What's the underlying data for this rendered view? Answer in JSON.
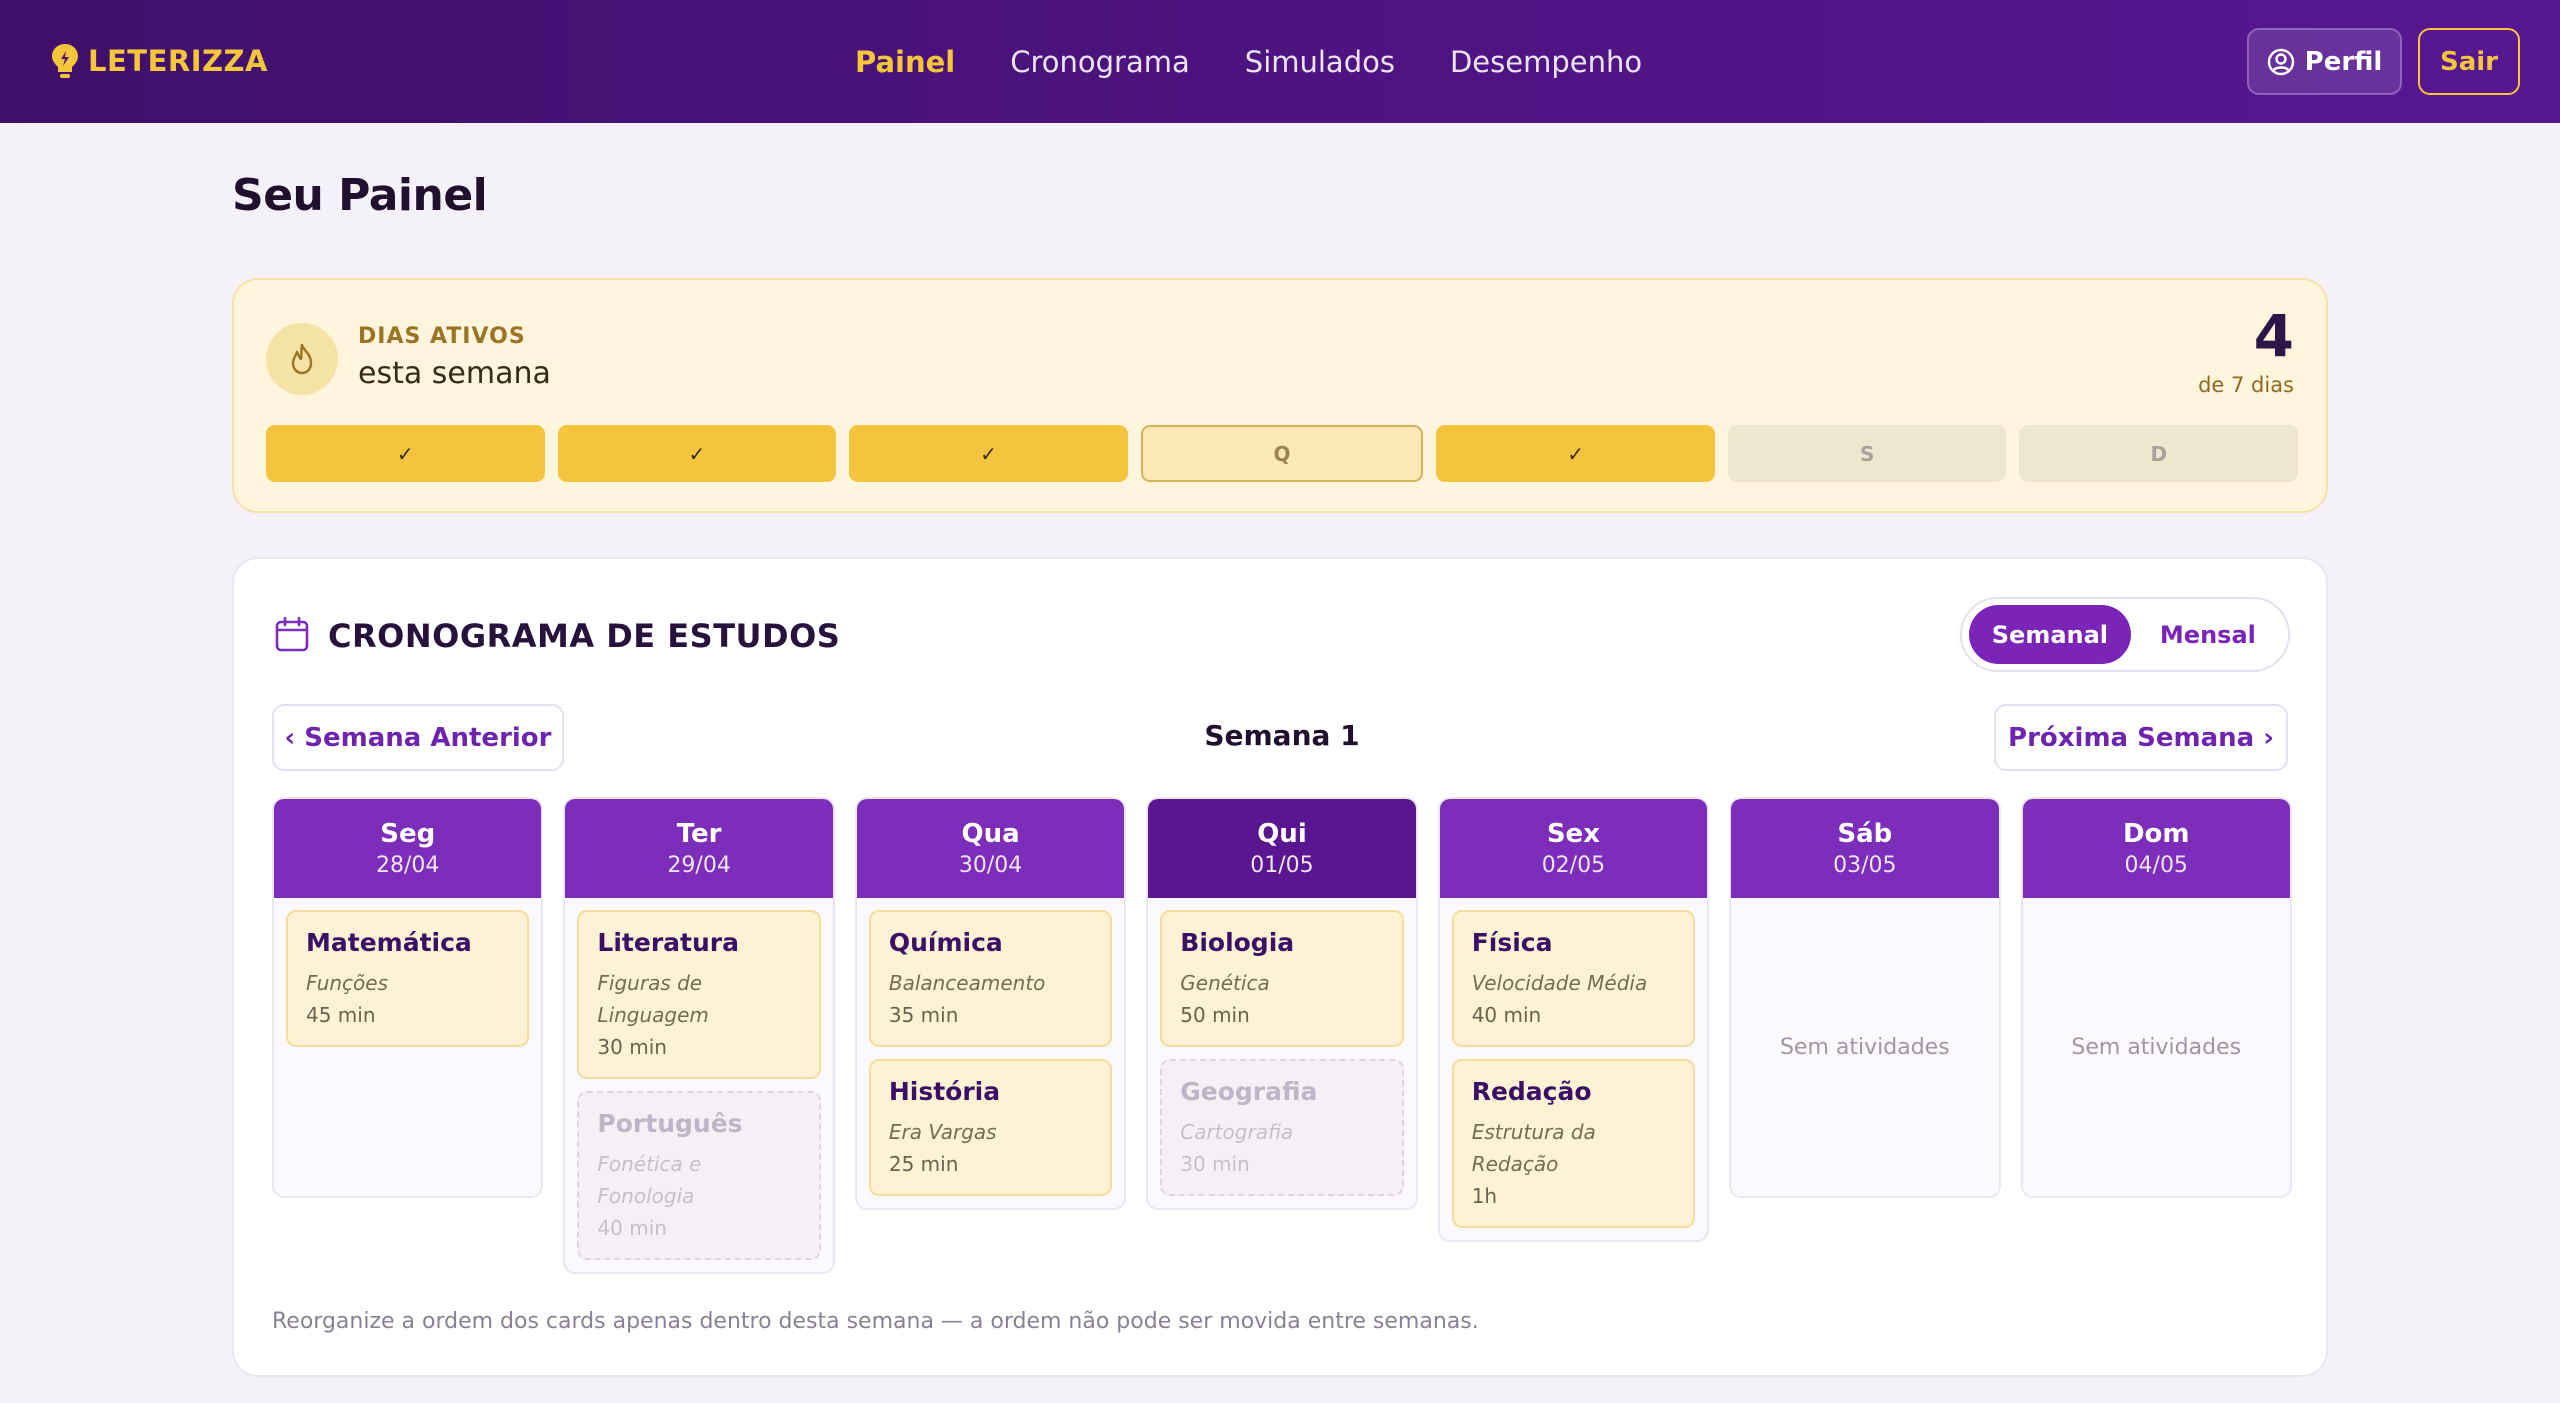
{
  "header": {
    "brand": "LETERIZZA",
    "nav": [
      "Painel",
      "Cronograma",
      "Simulados",
      "Desempenho"
    ],
    "active_nav": "Painel",
    "profile_label": "Perfil",
    "logout_label": "Sair"
  },
  "page": {
    "title": "Seu Painel"
  },
  "streak": {
    "label": "DIAS ATIVOS",
    "subtitle": "esta semana",
    "count": "4",
    "of_label": "de 7 dias",
    "days": [
      {
        "text": "✓",
        "state": "done"
      },
      {
        "text": "✓",
        "state": "done"
      },
      {
        "text": "✓",
        "state": "done"
      },
      {
        "text": "Q",
        "state": "today"
      },
      {
        "text": "✓",
        "state": "done"
      },
      {
        "text": "S",
        "state": "future"
      },
      {
        "text": "D",
        "state": "future"
      }
    ]
  },
  "schedule": {
    "title": "CRONOGRAMA DE ESTUDOS",
    "view_weekly": "Semanal",
    "view_monthly": "Mensal",
    "prev_week": "‹ Semana Anterior",
    "next_week": "Próxima Semana ›",
    "week_label": "Semana 1",
    "empty_text": "Sem atividades",
    "note": "Reorganize a ordem dos cards apenas dentro desta semana — a ordem não pode ser movida entre semanas.",
    "columns": [
      {
        "day": "Seg",
        "date": "28/04",
        "today": false,
        "tasks": [
          {
            "subject": "Matemática",
            "topic": "Funções",
            "duration": "45 min",
            "dim": false
          }
        ]
      },
      {
        "day": "Ter",
        "date": "29/04",
        "today": false,
        "tasks": [
          {
            "subject": "Literatura",
            "topic": "Figuras de Linguagem",
            "duration": "30 min",
            "dim": false
          },
          {
            "subject": "Português",
            "topic": "Fonética e Fonologia",
            "duration": "40 min",
            "dim": true
          }
        ]
      },
      {
        "day": "Qua",
        "date": "30/04",
        "today": false,
        "tasks": [
          {
            "subject": "Química",
            "topic": "Balanceamento",
            "duration": "35 min",
            "dim": false
          },
          {
            "subject": "História",
            "topic": "Era Vargas",
            "duration": "25 min",
            "dim": false
          }
        ]
      },
      {
        "day": "Qui",
        "date": "01/05",
        "today": true,
        "tasks": [
          {
            "subject": "Biologia",
            "topic": "Genética",
            "duration": "50 min",
            "dim": false
          },
          {
            "subject": "Geografia",
            "topic": "Cartografia",
            "duration": "30 min",
            "dim": true
          }
        ]
      },
      {
        "day": "Sex",
        "date": "02/05",
        "today": false,
        "tasks": [
          {
            "subject": "Física",
            "topic": "Velocidade Média",
            "duration": "40 min",
            "dim": false
          },
          {
            "subject": "Redação",
            "topic": "Estrutura da Redação",
            "duration": "1h",
            "dim": false
          }
        ]
      },
      {
        "day": "Sáb",
        "date": "03/05",
        "today": false,
        "tasks": []
      },
      {
        "day": "Dom",
        "date": "04/05",
        "today": false,
        "tasks": []
      }
    ]
  },
  "colors": {
    "header_bg": "#4d137f",
    "accent_yellow": "#f5c53a",
    "accent_purple": "#7c2dba",
    "today_purple": "#5a1690"
  },
  "icons": {
    "logo": "lightbulb-icon",
    "profile": "user-circle-icon",
    "streak": "flame-icon",
    "schedule": "calendar-icon"
  }
}
